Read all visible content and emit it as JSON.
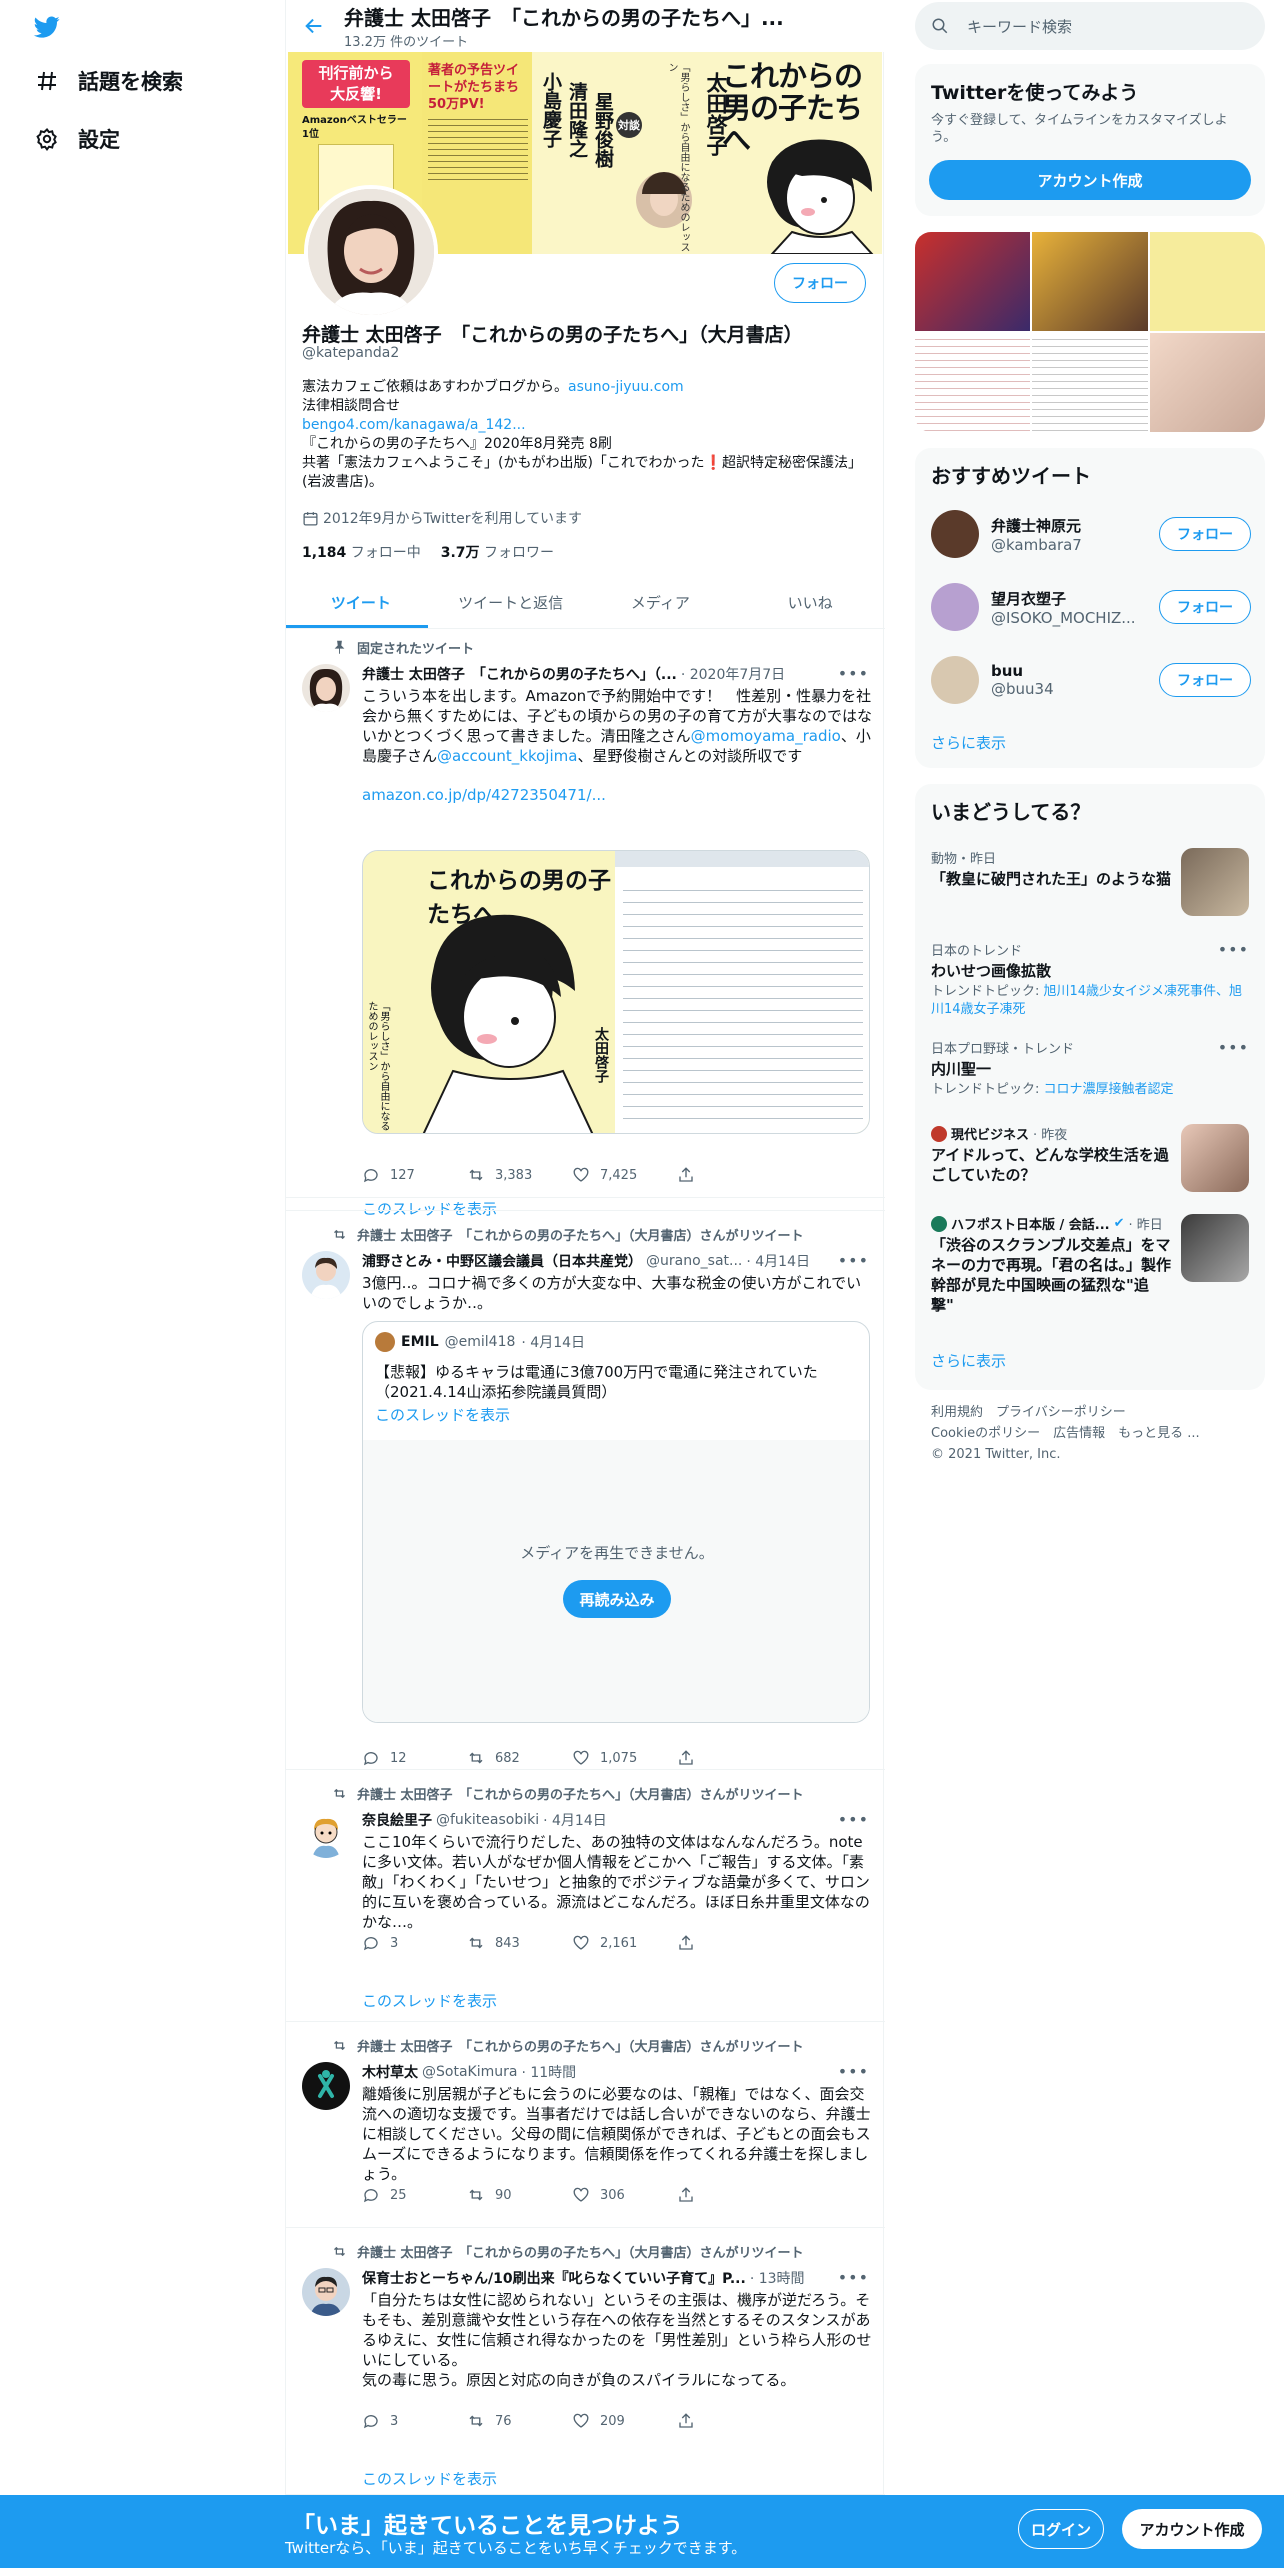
{
  "nav": {
    "items": [
      {
        "label": "話題を検索",
        "icon": "hash-icon"
      },
      {
        "label": "設定",
        "icon": "gear-icon"
      }
    ]
  },
  "header": {
    "title": "弁護士 太田啓子　「これからの男の子たちへ」...",
    "tweet_count": "13.2万 件のツイート"
  },
  "banner": {
    "badge": [
      "刊行前から",
      "大反響!"
    ],
    "amazon": "Amazonベストセラー1位",
    "preview": "著者の予告ツイートがたちまち50万PV!",
    "book_title": "これからの男の子たちへ",
    "author": "太田啓子",
    "taidan": "対談",
    "guests": [
      "小島慶子",
      "清田隆之",
      "星野俊樹"
    ],
    "tagline": "「男らしさ」から自由になるためのレッスン"
  },
  "profile": {
    "name": "弁護士 太田啓子　「これからの男の子たちへ」（大月書店）",
    "handle": "@katepanda2",
    "bio1": "憲法カフェご依頼はあすわかブログから。",
    "bio1_link": "asuno-jiyuu.com",
    "bio2": "法律相談問合せ",
    "bio3_link": "bengo4.com/kanagawa/a_142...",
    "bio4": "『これからの男の子たちへ』2020年8月発売 8刷",
    "bio5a": "共著「憲法カフェへようこそ」(かもがわ出版)「これでわかった",
    "bio5b": "超訳特定秘密保護法」(岩波書店)。",
    "joined": "2012年9月からTwitterを利用しています",
    "following_count": "1,184",
    "following_label": "フォロー中",
    "followers_count": "3.7万",
    "followers_label": "フォロワー",
    "follow_label": "フォロー"
  },
  "tabs": [
    "ツイート",
    "ツイートと返信",
    "メディア",
    "いいね"
  ],
  "tweets": [
    {
      "meta": "固定されたツイート",
      "name": "弁護士 太田啓子　「これからの男の子たちへ」（...",
      "time": "· 2020年7月7日",
      "text1": "こういう本を出します。Amazonで予約開始中です！　性差別・性暴力を社会から無くすためには、子どもの頃からの男の子の育て方が大事なのではないかとつくづく思って書きました。清田隆之さん",
      "mention1": "@momoyama_radio",
      "text2": "、小島慶子さん",
      "mention2": "@account_kkojima",
      "text3": "、星野俊樹さんとの対談所収です",
      "link": "amazon.co.jp/dp/4272350471/...",
      "replies": "127",
      "retweets": "3,383",
      "likes": "7,425",
      "thread": "このスレッドを表示"
    },
    {
      "meta": "弁護士 太田啓子　「これからの男の子たちへ」（大月書店）さんがリツイート",
      "name": "浦野さとみ・中野区議会議員（日本共産党）",
      "handle": "@urano_sat...",
      "time": "· 4月14日",
      "text": "3億円‥。コロナ禍で多くの方が大変な中、大事な税金の使い方がこれでいいのでしょうか‥。",
      "quote_name": "EMIL",
      "quote_handle": "@emil418",
      "quote_time": "· 4月14日",
      "quote_text": "【悲報】ゆるキャラは電通に3億700万円で電通に発注されていた（2021.4.14山添拓参院議員質問）",
      "quote_thread": "このスレッドを表示",
      "media_error": "メディアを再生できません。",
      "reload": "再読み込み",
      "replies": "12",
      "retweets": "682",
      "likes": "1,075"
    },
    {
      "meta": "弁護士 太田啓子　「これからの男の子たちへ」（大月書店）さんがリツイート",
      "name": "奈良絵里子",
      "handle": "@fukiteasobiki",
      "time": "· 4月14日",
      "text": "ここ10年くらいで流行りだした、あの独特の文体はなんなんだろう。noteに多い文体。若い人がなぜか個人情報をどこかへ「ご報告」する文体。「素敵」「わくわく」「たいせつ」と抽象的でポジティブな語彙が多くて、サロン的に互いを褒め合っている。源流はどこなんだろ。ほぼ日糸井重里文体なのかな…。",
      "replies": "3",
      "retweets": "843",
      "likes": "2,161",
      "thread": "このスレッドを表示"
    },
    {
      "meta": "弁護士 太田啓子　「これからの男の子たちへ」（大月書店）さんがリツイート",
      "name": "木村草太",
      "handle": "@SotaKimura",
      "time": "· 11時間",
      "text": "離婚後に別居親が子どもに会うのに必要なのは、「親権」ではなく、面会交流への適切な支援です。当事者だけでは話し合いができないのなら、弁護士に相談してください。父母の間に信頼関係ができれば、子どもとの面会もスムーズにできるようになります。信頼関係を作ってくれる弁護士を探しましょう。",
      "replies": "25",
      "retweets": "90",
      "likes": "306"
    },
    {
      "meta": "弁護士 太田啓子　「これからの男の子たちへ」（大月書店）さんがリツイート",
      "name": "保育士おとーちゃん/10刷出来『叱らなくていい子育て』P...",
      "time": "· 13時間",
      "text": "「自分たちは女性に認められない」というその主張は、機序が逆だろう。そもそも、差別意識や女性という存在への依存を当然とするそのスタンスがあるゆえに、女性に信頼され得なかったのを「男性差別」という枠ら人形のせいにしている。\n気の毒に思う。原因と対応の向きが負のスパイラルになってる。",
      "replies": "3",
      "retweets": "76",
      "likes": "209",
      "thread": "このスレッドを表示"
    }
  ],
  "right": {
    "search_placeholder": "キーワード検索",
    "signup_title": "Twitterを使ってみよう",
    "signup_desc": "今すぐ登録して、タイムラインをカスタマイズしよう。",
    "signup_button": "アカウント作成",
    "recommend_title": "おすすめツイート",
    "recommend": [
      {
        "name": "弁護士神原元",
        "handle": "@kambara7"
      },
      {
        "name": "望月衣塑子",
        "handle": "@ISOKO_MOCHIZ..."
      },
      {
        "name": "buu",
        "handle": "@buu34"
      }
    ],
    "follow_label": "フォロー",
    "show_more": "さらに表示",
    "trends_title": "いまどうしてる？",
    "trends": [
      {
        "cat": "動物・昨日",
        "name": "「教皇に破門された王」のような猫"
      },
      {
        "cat": "日本のトレンド",
        "name": "わいせつ画像拡散",
        "sub": "トレンドトピック: ",
        "sub_link": "旭川14歳少女イジメ凍死事件、旭川14歳女子凍死"
      },
      {
        "cat": "日本プロ野球・トレンド",
        "name": "内川聖一",
        "sub": "トレンドトピック: ",
        "sub_link": "コロナ濃厚接触者認定"
      },
      {
        "cat_name": "現代ビジネス",
        "cat_time": "· 昨夜",
        "name": "アイドルって、どんな学校生活を過ごしていたの？"
      },
      {
        "cat_name": "ハフポスト日本版 / 会話...",
        "cat_time": "· 昨日",
        "name": "「渋谷のスクランブル交差点」をマネーの力で再現。「君の名は。」製作幹部が見た中国映画の猛烈な\"追撃\""
      }
    ],
    "trends_more": "さらに表示",
    "footer1": "利用規約　プライバシーポリシー",
    "footer2": "Cookieのポリシー　広告情報　もっと見る ...",
    "footer3": "© 2021 Twitter, Inc."
  },
  "bottom": {
    "title": "「いま」起きていることを見つけよう",
    "sub": "Twitterなら、「いま」起きていることをいち早くチェックできます。",
    "login": "ログイン",
    "signup": "アカウント作成"
  },
  "colors": {
    "accent": "#1d9bf0",
    "text": "#0f1419",
    "muted": "#536471"
  }
}
